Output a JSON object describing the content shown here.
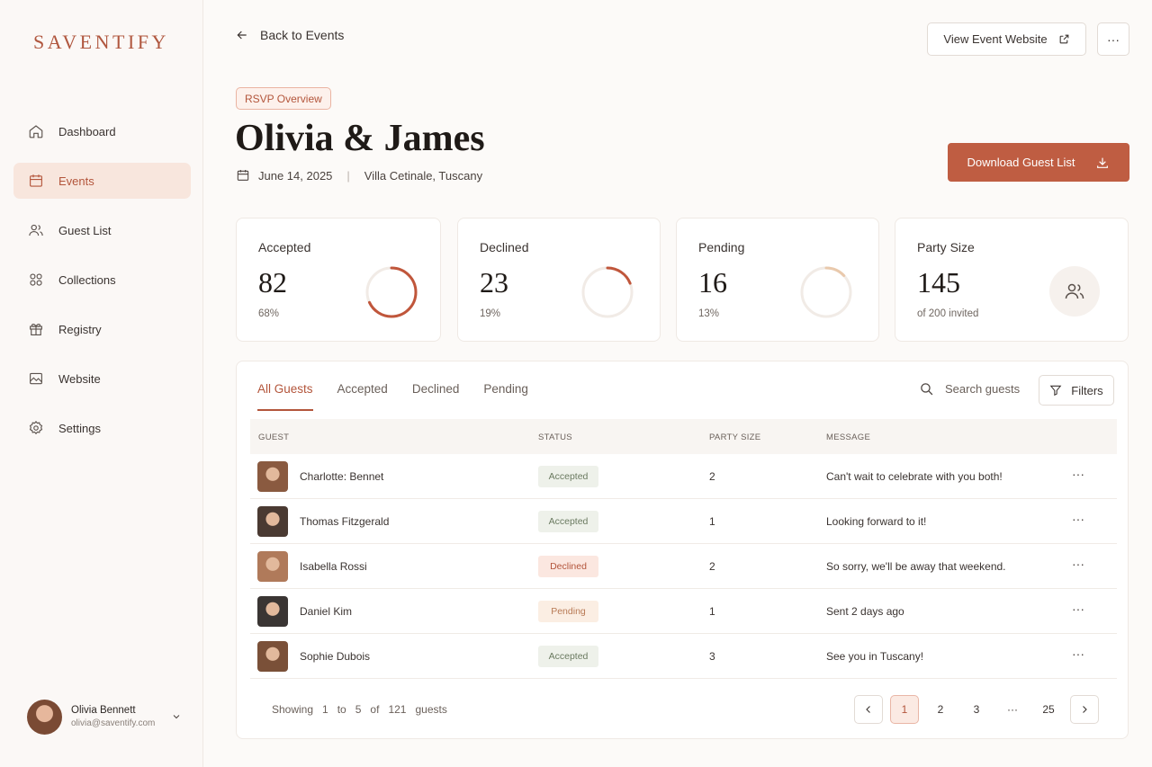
{
  "brand": {
    "logo_text": "SAVENTIFY",
    "accent_color": "#bf5d42"
  },
  "sidebar": {
    "items": [
      {
        "label": "Dashboard",
        "icon": "home-icon"
      },
      {
        "label": "Events",
        "icon": "calendar-icon",
        "active": true
      },
      {
        "label": "Guest List",
        "icon": "users-icon"
      },
      {
        "label": "Collections",
        "icon": "grid-icon"
      },
      {
        "label": "Registry",
        "icon": "gift-icon"
      },
      {
        "label": "Website",
        "icon": "image-icon"
      },
      {
        "label": "Settings",
        "icon": "gear-icon"
      }
    ],
    "user": {
      "name": "Olivia Bennett",
      "email": "olivia@saventify.com"
    }
  },
  "header": {
    "back_label": "Back to Events",
    "view_website_label": "View Event Website",
    "more_label": "···",
    "badge": "RSVP Overview",
    "title": "Olivia & James",
    "date": "June 14, 2025",
    "separator": "|",
    "location": "Villa Cetinale, Tuscany",
    "download_label": "Download Guest List"
  },
  "stats": [
    {
      "label": "Accepted",
      "value": "82",
      "sub": "68%",
      "fraction": 0.68,
      "color": "#c0563b"
    },
    {
      "label": "Declined",
      "value": "23",
      "sub": "19%",
      "fraction": 0.19,
      "color": "#c0563b"
    },
    {
      "label": "Pending",
      "value": "16",
      "sub": "13%",
      "fraction": 0.13,
      "color": "#e9c9ac"
    },
    {
      "label": "Party Size",
      "value": "145",
      "sub": "of 200 invited",
      "icon": "people-icon"
    }
  ],
  "table": {
    "tabs": [
      "All Guests",
      "Accepted",
      "Declined",
      "Pending"
    ],
    "active_tab": 0,
    "search_placeholder": "Search guests",
    "filters_label": "Filters",
    "columns": [
      "GUEST",
      "STATUS",
      "PARTY SIZE",
      "MESSAGE"
    ],
    "rows": [
      {
        "name": "Charlotte: Bennet",
        "status": "Accepted",
        "party": "2",
        "message": "Can't wait to celebrate with you both!",
        "avatar_color": "#8a5a40"
      },
      {
        "name": "Thomas Fitzgerald",
        "status": "Accepted",
        "party": "1",
        "message": "Looking forward to it!",
        "avatar_color": "#4a3a32"
      },
      {
        "name": "Isabella Rossi",
        "status": "Declined",
        "party": "2",
        "message": "So sorry, we'll be away that weekend.",
        "avatar_color": "#b07a5a"
      },
      {
        "name": "Daniel Kim",
        "status": "Pending",
        "party": "1",
        "message": "Sent 2 days ago",
        "avatar_color": "#3a3533"
      },
      {
        "name": "Sophie Dubois",
        "status": "Accepted",
        "party": "3",
        "message": "See you in Tuscany!",
        "avatar_color": "#7a5038"
      }
    ],
    "row_menu": "···",
    "footer": {
      "showing": "Showing",
      "from": "1",
      "to_word": "to",
      "to": "5",
      "of_word": "of",
      "total": "121",
      "unit": "guests"
    },
    "pagination": {
      "pages": [
        "1",
        "2",
        "3",
        "···",
        "25"
      ],
      "current": "1"
    }
  }
}
